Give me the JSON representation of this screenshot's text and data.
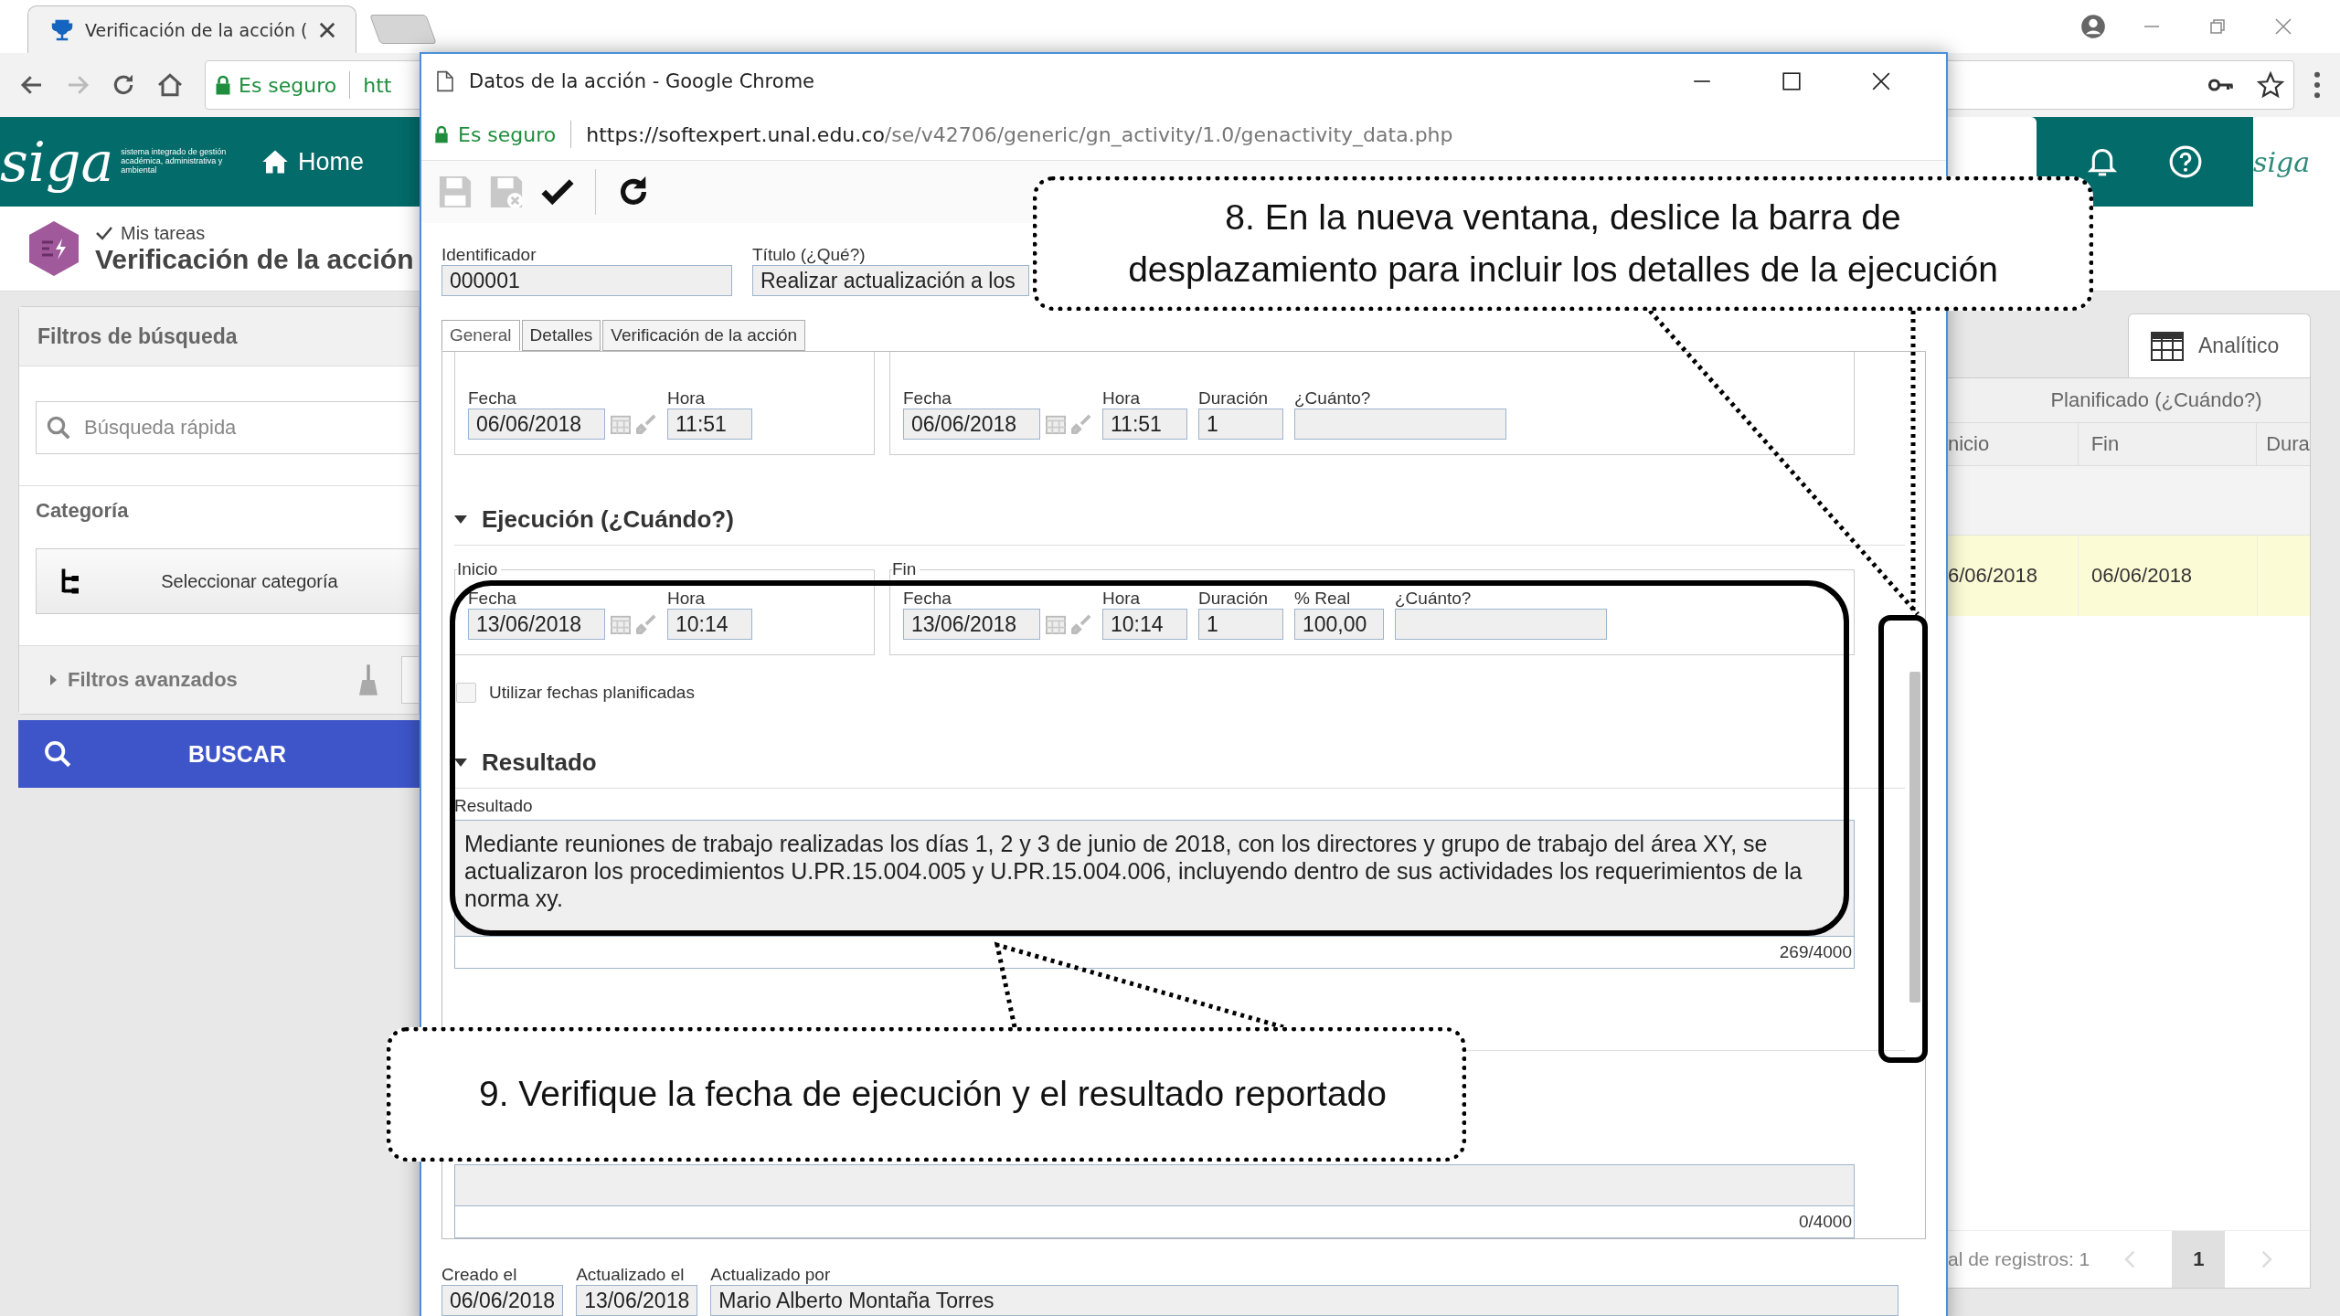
{
  "browser": {
    "tab_title": "Verificación de la acción (",
    "secure_label": "Es seguro",
    "url": "htt"
  },
  "app": {
    "logo": "siga",
    "tagline": "sistema integrado de gestión académica, administrativa y ambiental",
    "nav": [
      {
        "label": "Home"
      }
    ],
    "breadcrumb": "Mis tareas",
    "page_title": "Verificación de la acción",
    "corner_logo": "siga"
  },
  "filters": {
    "title": "Filtros de búsqueda",
    "search_placeholder": "Búsqueda rápida",
    "category_label": "Categoría",
    "category_button": "Seleccionar categoría",
    "advanced": {
      "label": "Filtros avanzados",
      "expanded": false
    },
    "search_button": "BUSCAR"
  },
  "right_panel": {
    "view_tab": "Analítico",
    "group_header": "Planificado (¿Cuándo?)",
    "columns": [
      "nicio",
      "Fin",
      "Dura"
    ],
    "rows": [
      {
        "cells": [
          "6/06/2018",
          "06/06/2018"
        ],
        "selected": true
      }
    ],
    "total": "al de registros: 1",
    "pages": [
      {
        "label": "1",
        "selected": true
      }
    ]
  },
  "popup": {
    "title": "Datos de la acción - Google Chrome",
    "secure_label": "Es seguro",
    "url_host": "https://softexpert.unal.edu.co",
    "url_path": "/se/v42706/generic/gn_activity/1.0/genactivity_data.php",
    "toolbar": [
      {
        "kind": "save",
        "disabled": true
      },
      {
        "kind": "save-close",
        "disabled": true
      },
      {
        "kind": "confirm",
        "disabled": false
      },
      {
        "kind": "refresh",
        "disabled": false
      }
    ],
    "fields": [
      {
        "label": "Identificador",
        "value": "000001"
      },
      {
        "label": "Título (¿Qué?)",
        "value": "Realizar actualización a los"
      }
    ],
    "tabs": [
      {
        "label": "General",
        "selected": true
      },
      {
        "label": "Detalles",
        "selected": false
      },
      {
        "label": "Verificación de la acción",
        "selected": false
      }
    ],
    "planned_groups": [
      {
        "fields": [
          {
            "label": "Fecha",
            "value": "06/06/2018",
            "kind": "date"
          },
          {
            "label": "Hora",
            "value": "11:51",
            "kind": "time"
          }
        ]
      },
      {
        "fields": [
          {
            "label": "Fecha",
            "value": "06/06/2018",
            "kind": "date"
          },
          {
            "label": "Hora",
            "value": "11:51",
            "kind": "time"
          },
          {
            "label": "Duración",
            "value": "1",
            "kind": "number"
          },
          {
            "label": "¿Cuánto?",
            "kind": "amount"
          }
        ]
      }
    ],
    "execution": {
      "title": "Ejecución (¿Cuándo?)",
      "expanded": true,
      "groups": [
        {
          "legend": "Inicio",
          "fields": [
            {
              "label": "Fecha",
              "value": "13/06/2018",
              "kind": "date"
            },
            {
              "label": "Hora",
              "value": "10:14",
              "kind": "time"
            }
          ]
        },
        {
          "legend": "Fin",
          "fields": [
            {
              "label": "Fecha",
              "value": "13/06/2018",
              "kind": "date"
            },
            {
              "label": "Hora",
              "value": "10:14",
              "kind": "time"
            },
            {
              "label": "Duración",
              "value": "1",
              "kind": "number"
            },
            {
              "label": "% Real",
              "value": "100,00",
              "kind": "percent"
            },
            {
              "label": "¿Cuánto?",
              "kind": "amount"
            }
          ]
        }
      ],
      "use_planned": {
        "label": "Utilizar fechas planificadas",
        "checked": false
      }
    },
    "result": {
      "title": "Resultado",
      "expanded": true,
      "field_label": "Resultado",
      "text": "Mediante reuniones de trabajo realizadas los días 1, 2 y 3 de junio de 2018, con los directores y grupo de trabajo del área XY, se actualizaron los procedimientos U.PR.15.004.005 y U.PR.15.004.006, incluyendo dentro de sus actividades los requerimientos de la norma xy.",
      "counter": "269/4000"
    },
    "second_box": {
      "counter": "0/4000"
    },
    "footer_fields": [
      {
        "label": "Creado el",
        "value": "06/06/2018"
      },
      {
        "label": "Actualizado el",
        "value": "13/06/2018"
      },
      {
        "label": "Actualizado por",
        "value": "Mario Alberto Montaña Torres"
      }
    ]
  },
  "callouts": [
    {
      "lines": [
        "8. En la nueva ventana, deslice la barra de",
        "desplazamiento para incluir los detalles de la ejecución"
      ]
    },
    {
      "lines": [
        "9. Verifique la fecha de ejecución y el resultado reportado"
      ]
    }
  ]
}
